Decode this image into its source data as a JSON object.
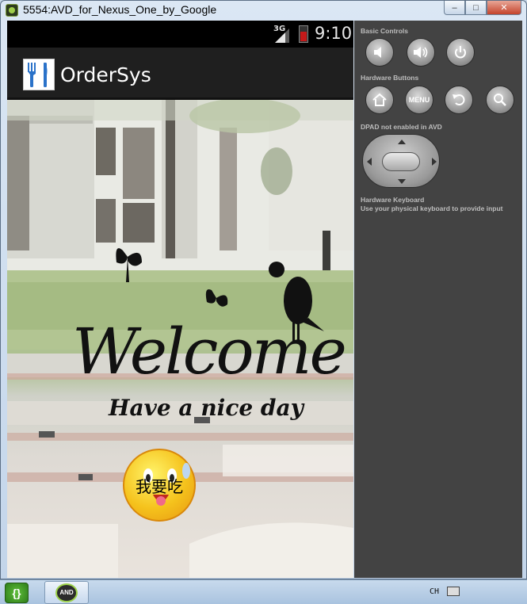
{
  "window": {
    "title": "5554:AVD_for_Nexus_One_by_Google",
    "minimize": "‒",
    "maximize": "□",
    "close": "✕"
  },
  "status_bar": {
    "network": "3G",
    "time": "9:10"
  },
  "app": {
    "title": "OrderSys",
    "icon": "fork-knife-icon"
  },
  "welcome": {
    "order_button_label": "我要吃"
  },
  "controls": {
    "basic_label": "Basic Controls",
    "hardware_buttons_label": "Hardware Buttons",
    "menu_label": "MENU",
    "dpad_label": "DPAD not enabled in AVD",
    "keyboard_label": "Hardware Keyboard",
    "keyboard_hint": "Use your physical keyboard to provide input"
  },
  "taskbar": {
    "start_glyph": "{}",
    "app_label": "AND",
    "language": "CH"
  }
}
